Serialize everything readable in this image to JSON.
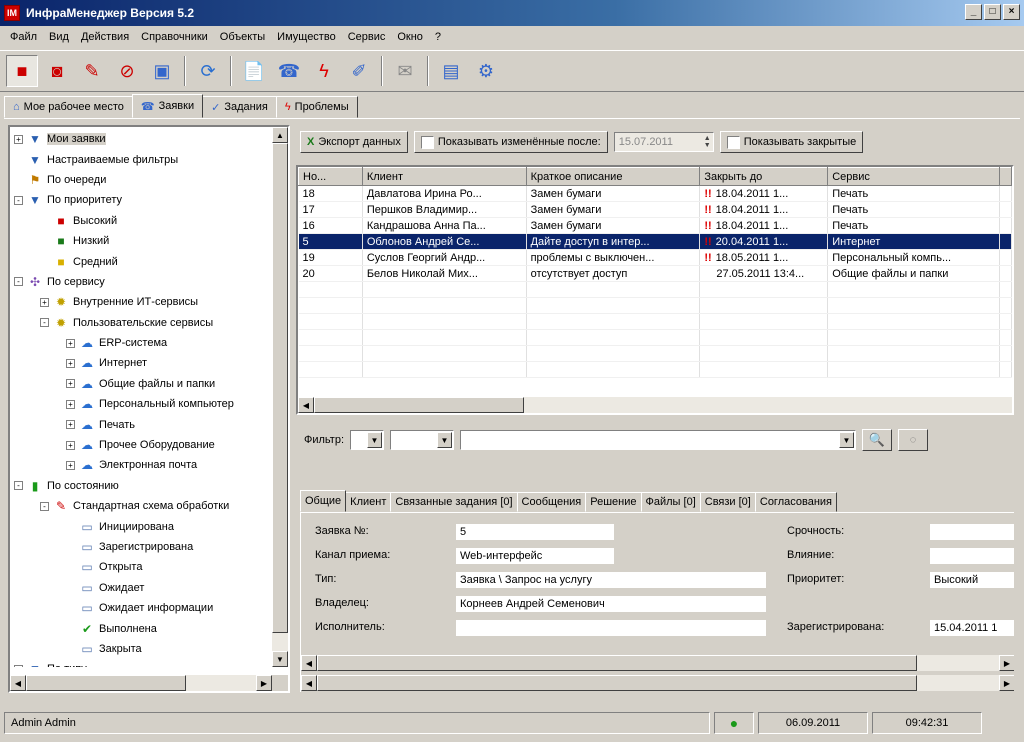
{
  "app": {
    "title": "ИнфраМенеджер Версия 5.2"
  },
  "menu": [
    "Файл",
    "Вид",
    "Действия",
    "Справочники",
    "Объекты",
    "Имущество",
    "Сервис",
    "Окно",
    "?"
  ],
  "main_tabs": [
    {
      "label": "Мое рабочее место",
      "icon": "home-icon"
    },
    {
      "label": "Заявки",
      "icon": "phone-icon"
    },
    {
      "label": "Задания",
      "icon": "task-icon"
    },
    {
      "label": "Проблемы",
      "icon": "problem-icon"
    }
  ],
  "tree": [
    {
      "label": "Мои заявки",
      "level": 0,
      "exp": "+",
      "icon": "filter-icon",
      "selected": true
    },
    {
      "label": "Настраиваемые фильтры",
      "level": 0,
      "exp": "",
      "icon": "filter-icon"
    },
    {
      "label": "По очереди",
      "level": 0,
      "exp": "",
      "icon": "queue-icon"
    },
    {
      "label": "По приоритету",
      "level": 0,
      "exp": "-",
      "icon": "filter-icon"
    },
    {
      "label": "Высокий",
      "level": 1,
      "exp": "",
      "icon": "priority-high-icon"
    },
    {
      "label": "Низкий",
      "level": 1,
      "exp": "",
      "icon": "priority-low-icon"
    },
    {
      "label": "Средний",
      "level": 1,
      "exp": "",
      "icon": "priority-medium-icon"
    },
    {
      "label": "По сервису",
      "level": 0,
      "exp": "-",
      "icon": "service-icon"
    },
    {
      "label": "Внутренние ИТ-сервисы",
      "level": 1,
      "exp": "+",
      "icon": "bulb-icon"
    },
    {
      "label": "Пользовательские сервисы",
      "level": 1,
      "exp": "-",
      "icon": "bulb-icon"
    },
    {
      "label": "ERP-система",
      "level": 2,
      "exp": "+",
      "icon": "cloud-icon"
    },
    {
      "label": "Интернет",
      "level": 2,
      "exp": "+",
      "icon": "cloud-icon"
    },
    {
      "label": "Общие файлы и папки",
      "level": 2,
      "exp": "+",
      "icon": "cloud-icon"
    },
    {
      "label": "Персональный компьютер",
      "level": 2,
      "exp": "+",
      "icon": "cloud-icon"
    },
    {
      "label": "Печать",
      "level": 2,
      "exp": "+",
      "icon": "cloud-icon"
    },
    {
      "label": "Прочее Оборудование",
      "level": 2,
      "exp": "+",
      "icon": "cloud-icon"
    },
    {
      "label": "Электронная почта",
      "level": 2,
      "exp": "+",
      "icon": "cloud-icon"
    },
    {
      "label": "По состоянию",
      "level": 0,
      "exp": "-",
      "icon": "traffic-light-icon"
    },
    {
      "label": "Стандартная схема обработки",
      "level": 1,
      "exp": "-",
      "icon": "workflow-icon"
    },
    {
      "label": "Инициирована",
      "level": 2,
      "exp": "",
      "icon": "state-icon"
    },
    {
      "label": "Зарегистрирована",
      "level": 2,
      "exp": "",
      "icon": "state-icon"
    },
    {
      "label": "Открыта",
      "level": 2,
      "exp": "",
      "icon": "state-icon"
    },
    {
      "label": "Ожидает",
      "level": 2,
      "exp": "",
      "icon": "state-icon"
    },
    {
      "label": "Ожидает информации",
      "level": 2,
      "exp": "",
      "icon": "state-icon"
    },
    {
      "label": "Выполнена",
      "level": 2,
      "exp": "",
      "icon": "check-icon"
    },
    {
      "label": "Закрыта",
      "level": 2,
      "exp": "",
      "icon": "state-icon"
    },
    {
      "label": "По типу",
      "level": 0,
      "exp": "+",
      "icon": "filter-icon"
    }
  ],
  "filterbar": {
    "export_label": "Экспорт данных",
    "show_changed_label": "Показывать изменённые после:",
    "date_value": "15.07.2011",
    "show_closed_label": "Показывать закрытые"
  },
  "grid": {
    "columns": [
      "Но...",
      "Клиент",
      "Краткое описание",
      "Закрыть до",
      "Сервис"
    ],
    "rows": [
      {
        "no": "18",
        "client": "Давлатова Ирина Ро...",
        "desc": "Замен бумаги",
        "due": "18.04.2011 1...",
        "urgent": true,
        "service": "Печать"
      },
      {
        "no": "17",
        "client": "Першков Владимир...",
        "desc": "Замен бумаги",
        "due": "18.04.2011 1...",
        "urgent": true,
        "service": "Печать"
      },
      {
        "no": "16",
        "client": "Кандрашова Анна Па...",
        "desc": "Замен бумаги",
        "due": "18.04.2011 1...",
        "urgent": true,
        "service": "Печать"
      },
      {
        "no": "5",
        "client": "Облонов Андрей Се...",
        "desc": "Дайте доступ в интер...",
        "due": "20.04.2011 1...",
        "urgent": true,
        "service": "Интернет",
        "selected": true
      },
      {
        "no": "19",
        "client": "Суслов Георгий Андр...",
        "desc": "проблемы с выключен...",
        "due": "18.05.2011 1...",
        "urgent": true,
        "service": "Персональный компь..."
      },
      {
        "no": "20",
        "client": "Белов Николай Мих...",
        "desc": "отсутствует доступ",
        "due": "27.05.2011 13:4...",
        "urgent": false,
        "service": "Общие файлы и папки"
      }
    ]
  },
  "filter2": {
    "label": "Фильтр:"
  },
  "detail_tabs": [
    "Общие",
    "Клиент",
    "Связанные задания [0]",
    "Сообщения",
    "Решение",
    "Файлы [0]",
    "Связи [0]",
    "Согласования"
  ],
  "detail": {
    "fields_left": [
      {
        "label": "Заявка №:",
        "value": "5"
      },
      {
        "label": "Канал приема:",
        "value": "Web-интерфейс"
      },
      {
        "label": "Тип:",
        "value": "Заявка \\ Запрос на услугу"
      },
      {
        "label": "Владелец:",
        "value": "Корнеев Андрей Семенович"
      },
      {
        "label": "Исполнитель:",
        "value": ""
      }
    ],
    "fields_right": [
      {
        "label": "Срочность:",
        "value": ""
      },
      {
        "label": "Влияние:",
        "value": ""
      },
      {
        "label": "Приоритет:",
        "value": "Высокий"
      },
      {
        "label": "Зарегистрирована:",
        "value": "15.04.2011 1"
      }
    ]
  },
  "status": {
    "user": "Admin Admin",
    "date": "06.09.2011",
    "time": "09:42:31"
  }
}
